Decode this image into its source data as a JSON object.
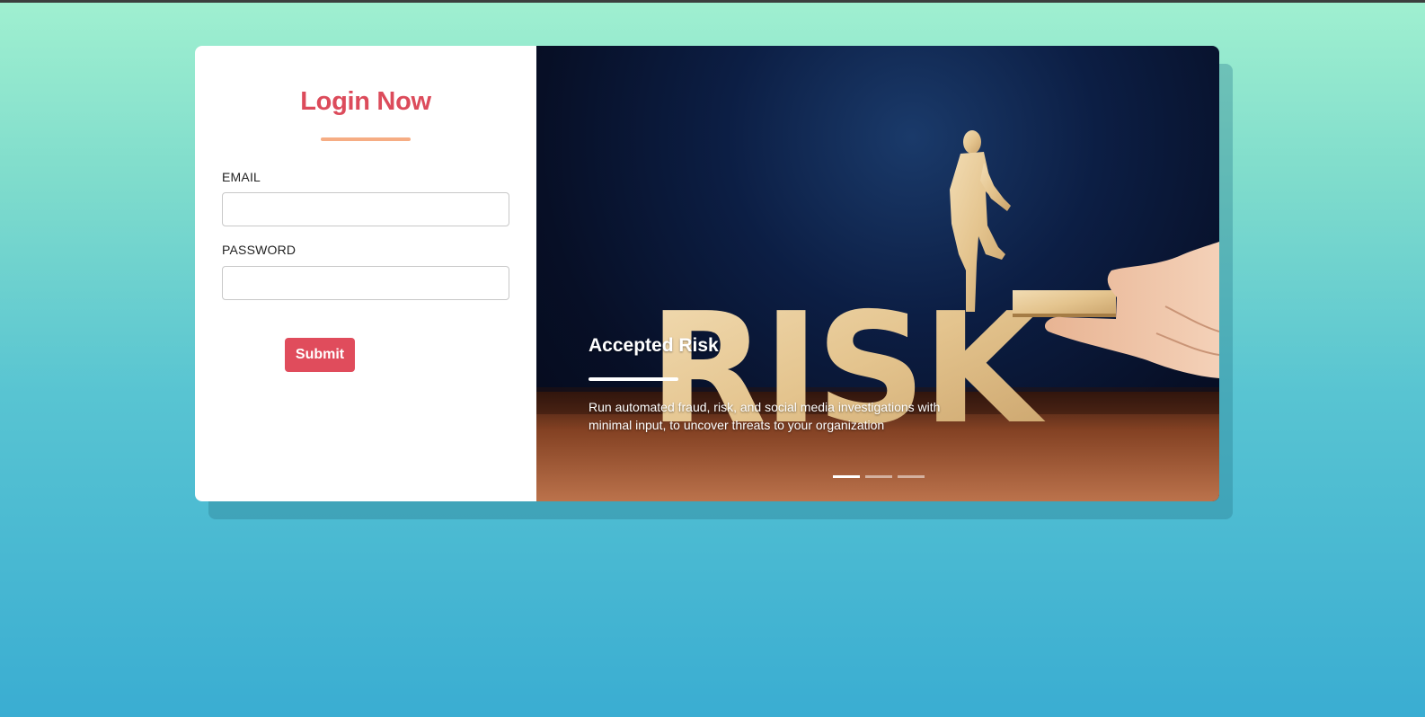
{
  "login": {
    "title": "Login Now",
    "email_label": "EMAIL",
    "email_value": "",
    "password_label": "PASSWORD",
    "password_value": "",
    "submit_label": "Submit"
  },
  "carousel": {
    "slide_title": "Accepted Risk",
    "slide_text": "Run automated fraud, risk, and social media investigations with minimal input, to uncover threats to your organization",
    "image_word": "RISK",
    "indicators": 3,
    "active_index": 0
  },
  "colors": {
    "accent": "#dc4b5b",
    "underline": "#f6ad84",
    "button": "#e04c5c"
  }
}
